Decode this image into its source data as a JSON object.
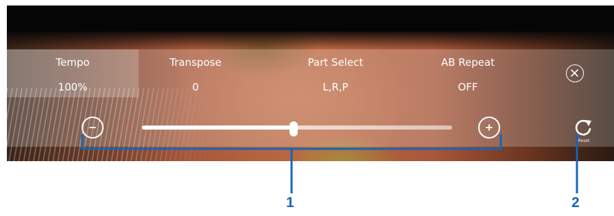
{
  "tabs": [
    {
      "label": "Tempo",
      "value": "100%",
      "active": true
    },
    {
      "label": "Transpose",
      "value": "0",
      "active": false
    },
    {
      "label": "Part Select",
      "value": "L,R,P",
      "active": false
    },
    {
      "label": "AB Repeat",
      "value": "OFF",
      "active": false
    }
  ],
  "slider": {
    "minus_icon": "minus-circle-icon",
    "plus_icon": "plus-circle-icon",
    "level": 0.49
  },
  "reset": {
    "label": "Reset",
    "icon": "reset-icon"
  },
  "close": {
    "icon": "close-circle-icon"
  },
  "callouts": {
    "one": "1",
    "two": "2",
    "color": "#1565b8"
  }
}
